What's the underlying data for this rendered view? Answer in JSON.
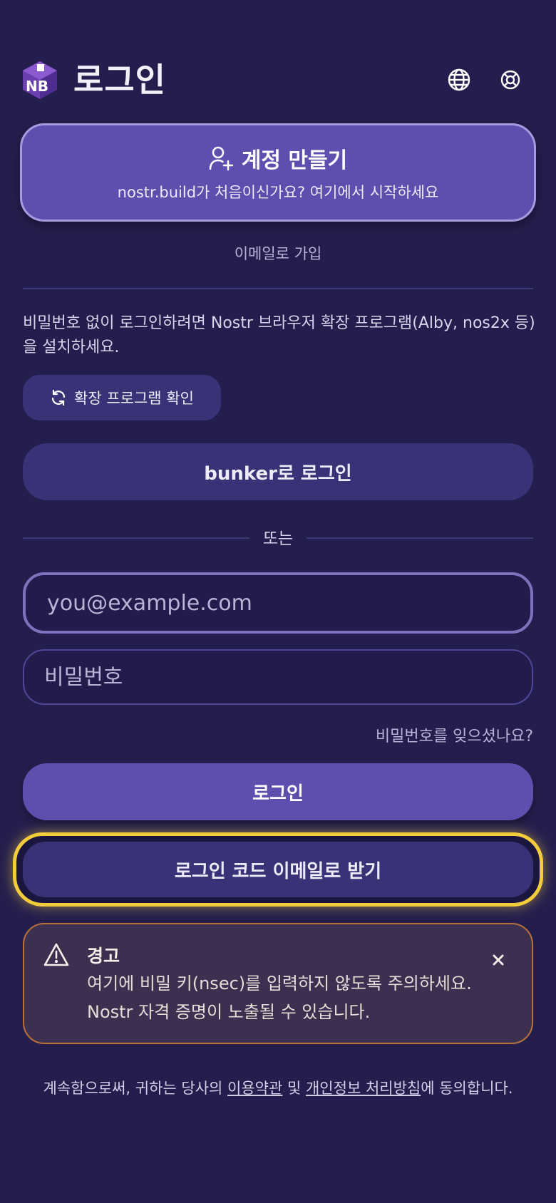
{
  "header": {
    "logo_text": "NB",
    "title": "로그인",
    "language_icon": "globe-icon",
    "help_icon": "lifebuoy-icon"
  },
  "create_account": {
    "icon": "user-plus-icon",
    "title": "계정 만들기",
    "subtitle": "nostr.build가 처음이신가요? 여기에서 시작하세요"
  },
  "email_signup_link": "이메일로 가입",
  "extension_info": "비밀번호 없이 로그인하려면 Nostr 브라우저 확장 프로그램(Alby, nos2x 등)을 설치하세요.",
  "check_extension_label": "확장 프로그램 확인",
  "bunker_login_label": "bunker로 로그인",
  "or_label": "또는",
  "email_input": {
    "value": "",
    "placeholder": "you@example.com"
  },
  "password_input": {
    "value": "",
    "placeholder": "비밀번호"
  },
  "forgot_password_label": "비밀번호를 잊으셨나요?",
  "login_label": "로그인",
  "email_code_label": "로그인 코드 이메일로 받기",
  "warning": {
    "icon": "warning-triangle-icon",
    "title": "경고",
    "body": "여기에 비밀 키(nsec)를 입력하지 않도록 주의하세요. Nostr 자격 증명이 노출될 수 있습니다."
  },
  "terms": {
    "prefix": "계속함으로써, 귀하는 당사의 ",
    "terms_link": "이용약관",
    "and": " 및 ",
    "privacy_link": "개인정보 처리방침",
    "suffix": "에 동의합니다."
  },
  "colors": {
    "background": "#241e4e",
    "primary": "#5c4fae",
    "secondary": "#3a3276",
    "highlight": "#f3cc3c",
    "warning_border": "#b9713b"
  }
}
